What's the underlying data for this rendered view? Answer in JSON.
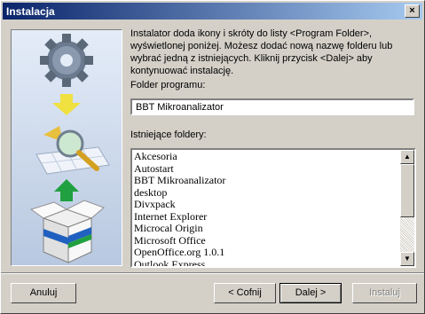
{
  "window": {
    "title": "Instalacja",
    "close_label": "×"
  },
  "description": "Instalator doda ikony i skróty do listy <Program Folder>, wyświetlonej poniżej. Możesz dodać nową nazwę folderu lub wybrać jedną z istniejących. Kliknij przycisk <Dalej> aby kontynuować instalację.",
  "program_folder": {
    "label": "Folder programu:",
    "value": "BBT Mikroanalizator"
  },
  "existing_folders": {
    "label": "Istniejące foldery:",
    "items": [
      "Akcesoria",
      "Autostart",
      "BBT Mikroanalizator",
      "desktop",
      "Divxpack",
      "Internet Explorer",
      "Microcal Origin",
      "Microsoft Office",
      "OpenOffice.org 1.0.1",
      "Outlook Express"
    ]
  },
  "buttons": {
    "cancel": "Anuluj",
    "back": "< Cofnij",
    "next": "Dalej >",
    "install": "Instaluj"
  }
}
